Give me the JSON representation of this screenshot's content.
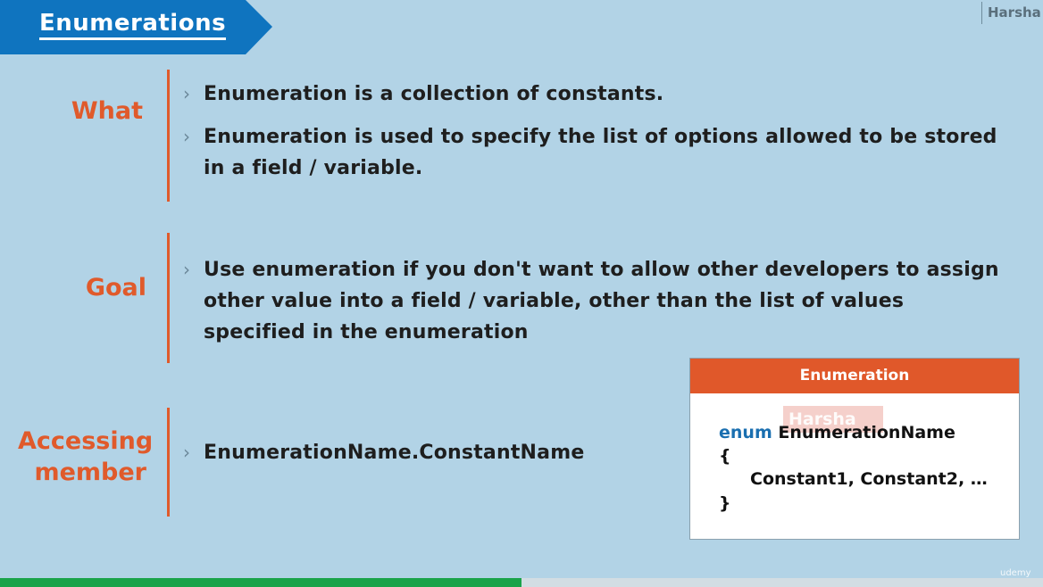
{
  "slide": {
    "title": "Enumerations",
    "author": "Harsha"
  },
  "sections": [
    {
      "label": "What",
      "items": [
        "Enumeration is a collection of constants.",
        "Enumeration is used to specify the list of options allowed to be stored in a field / variable."
      ]
    },
    {
      "label": "Goal",
      "items": [
        "Use enumeration if you don't want to allow other developers to assign other value into a field / variable, other than the list of values specified in the enumeration"
      ]
    },
    {
      "label": "Accessing member",
      "items": [
        "EnumerationName.ConstantName"
      ]
    }
  ],
  "code_box": {
    "header": "Enumeration",
    "watermark": "Harsha",
    "keyword": "enum",
    "name": "EnumerationName",
    "open_brace": "{",
    "body": "Constant1, Constant2, …",
    "close_brace": "}"
  },
  "player": {
    "progress": 0.5,
    "brand": "udemy"
  },
  "colors": {
    "background": "#b2d3e6",
    "title_banner": "#0f74bf",
    "accent": "#e05a2b",
    "keyword": "#1a6fb0",
    "progress": "#1aa34a"
  }
}
